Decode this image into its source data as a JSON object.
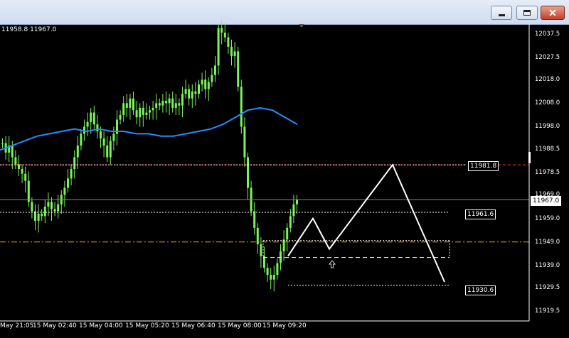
{
  "window": {
    "minimize_icon": "minimize-icon",
    "maximize_icon": "maximize-icon",
    "close_icon": "close-icon",
    "close_glyph": "✕"
  },
  "chart_header": {
    "ohlc_text": "11958.8 11967.0"
  },
  "price_axis": {
    "ticks": [
      "12037.5",
      "12027.5",
      "12018.0",
      "12008.0",
      "11998.0",
      "11988.5",
      "11978.5",
      "11969.0",
      "11959.0",
      "11949.0",
      "11939.0",
      "11929.5",
      "11919.5"
    ],
    "current_price": "11967.0"
  },
  "time_axis": {
    "ticks": [
      "May 21:05",
      "15 May 02:40",
      "15 May 04:00",
      "15 May 05:20",
      "15 May 06:40",
      "15 May 08:00",
      "15 May 09:20"
    ]
  },
  "levels": {
    "resistance": "11981.8",
    "upper": "11961.6",
    "lower": "11930.6"
  },
  "colors": {
    "candle": "#7cf35b",
    "moving_average": "#1f8fff",
    "resistance_line": "#ff3030",
    "orange_line": "#ff9a1a",
    "projection": "#ffffff"
  },
  "chart_data": {
    "type": "candlestick",
    "ylim": [
      11916,
      12041
    ],
    "close_series": [
      11991,
      11987,
      11990,
      11985,
      11982,
      11980,
      11978,
      11975,
      11966,
      11962,
      11958,
      11961,
      11960,
      11964,
      11966,
      11963,
      11962,
      11965,
      11969,
      11972,
      11976,
      11980,
      11985,
      11990,
      11995,
      11998,
      12000,
      12004,
      11999,
      11996,
      11993,
      11990,
      11985,
      11992,
      11995,
      12001,
      12003,
      12008,
      12006,
      12010,
      12005,
      12002,
      12006,
      12003,
      12004,
      12005,
      12006,
      12008,
      12007,
      12009,
      12008,
      12010,
      12006,
      12008,
      12007,
      12012,
      12014,
      12010,
      12013,
      12012,
      12016,
      12018,
      12014,
      12017,
      12020,
      12024,
      12040,
      12038,
      12036,
      12032,
      12028,
      12030,
      12015,
      11998,
      11985,
      11972,
      11962,
      11955,
      11948,
      11943,
      11938,
      11935,
      11933,
      11935,
      11940,
      11945,
      11950,
      11955,
      11960,
      11965,
      11967
    ],
    "moving_average": [
      11988,
      11990,
      11992,
      11994,
      11995,
      11996,
      11997,
      11996,
      11997,
      11996,
      11996,
      11995,
      11995,
      11994,
      11994,
      11995,
      11996,
      11997,
      11999,
      12002,
      12005,
      12006,
      12005,
      12002,
      11999
    ],
    "levels": [
      11981.8,
      11961.6,
      11930.6
    ],
    "orange_level": 11949.0,
    "projection": [
      11943,
      11959,
      11946,
      11981.8,
      11932
    ]
  }
}
